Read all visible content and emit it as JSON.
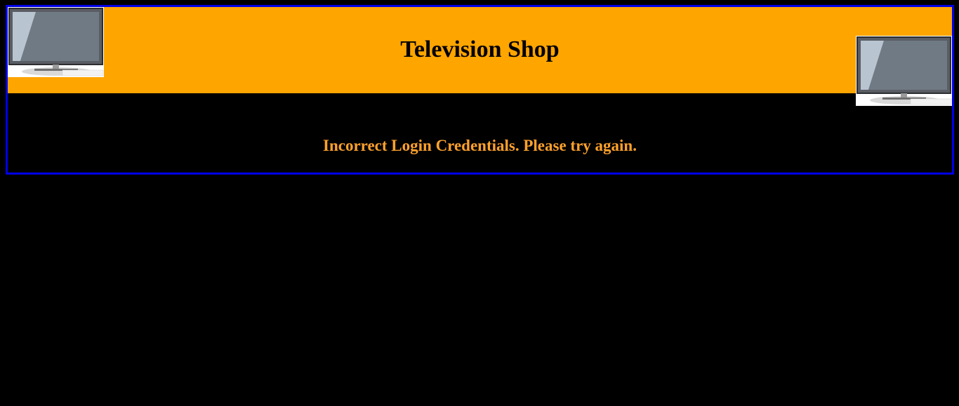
{
  "header": {
    "title": "Television Shop"
  },
  "message": {
    "text": "Incorrect Login Credentials. Please try again."
  },
  "images": {
    "left": "television-icon",
    "right": "television-icon"
  },
  "colors": {
    "page_background": "#000000",
    "banner": "#ffa500",
    "frame_border": "#0000e6",
    "message_text": "#ffa12c",
    "title_text": "#000000"
  }
}
